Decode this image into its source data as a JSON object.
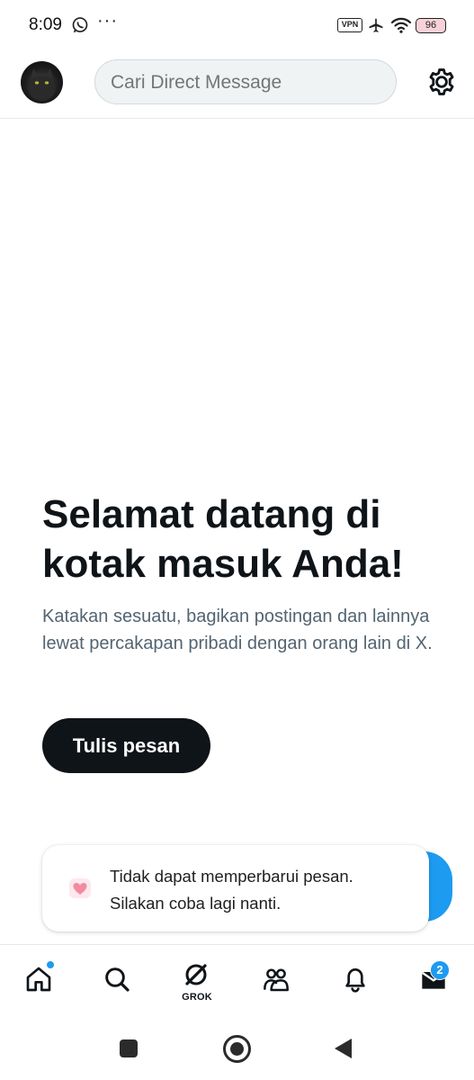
{
  "status_bar": {
    "time": "8:09",
    "notification_icons": [
      "whatsapp-icon",
      "more-dots-icon"
    ],
    "overflow": "···",
    "vpn_label": "VPN",
    "system_icons": [
      "vpn-icon",
      "airplane-icon",
      "wifi-icon",
      "battery-icon"
    ],
    "battery": "96"
  },
  "header": {
    "avatar_icon": "profile-avatar",
    "search_placeholder": "Cari Direct Message",
    "settings_icon": "gear-icon"
  },
  "empty_state": {
    "title": "Selamat datang di kotak masuk Anda!",
    "description": "Katakan sesuatu, bagikan postingan dan lainnya lewat percakapan pribadi dengan orang lain di X.",
    "button_label": "Tulis pesan"
  },
  "toast": {
    "icon": "heart-app-icon",
    "line1": "Tidak dapat memperbarui pesan.",
    "line2": "Silakan coba lagi nanti."
  },
  "bottom_nav": {
    "items": [
      {
        "icon": "home-icon",
        "has_dot": true
      },
      {
        "icon": "search-icon"
      },
      {
        "icon": "grok-icon",
        "label": "GROK"
      },
      {
        "icon": "communities-icon"
      },
      {
        "icon": "bell-icon"
      },
      {
        "icon": "mail-icon",
        "badge": "2",
        "active": true
      }
    ]
  },
  "system_nav": [
    "recents-button",
    "home-button",
    "back-button"
  ],
  "colors": {
    "accent": "#1d9bf0",
    "text_primary": "#0f1419",
    "text_secondary": "#536471",
    "search_bg": "#eff3f4",
    "button_bg": "#0f1419",
    "battery_bg": "#f8d2d8"
  }
}
